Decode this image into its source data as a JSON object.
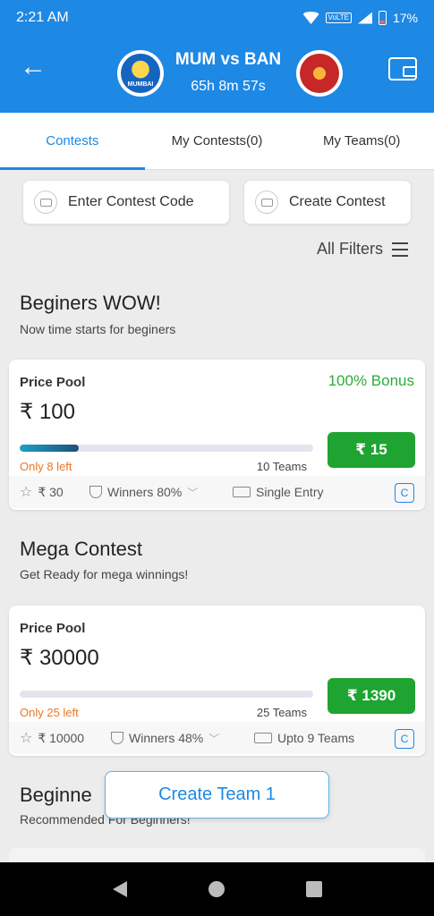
{
  "status_bar": {
    "time": "2:21 AM",
    "battery": "17%"
  },
  "header": {
    "team1_logo_text": "MUMBAI",
    "match_title": "MUM vs BAN",
    "countdown": "65h 8m 57s"
  },
  "tabs": [
    {
      "label": "Contests",
      "active": true
    },
    {
      "label": "My Contests(0)",
      "active": false
    },
    {
      "label": "My Teams(0)",
      "active": false
    }
  ],
  "actions": {
    "enter_code": "Enter Contest Code",
    "create_contest": "Create Contest"
  },
  "filters_label": "All Filters",
  "sections": [
    {
      "title": "Beginers WOW!",
      "subtitle": "Now time starts for beginers",
      "card": {
        "label": "Price Pool",
        "bonus": "100% Bonus",
        "amount": "₹ 100",
        "fill_fraction": 0.2,
        "spots_left": "Only 8 left",
        "teams": "10 Teams",
        "entry": "₹ 15",
        "first_prize": "₹ 30",
        "winners": "Winners 80%",
        "entry_type": "Single Entry",
        "badge": "C"
      }
    },
    {
      "title": "Mega Contest",
      "subtitle": "Get Ready for mega winnings!",
      "card": {
        "label": "Price Pool",
        "amount": "₹ 30000",
        "fill_fraction": 0.0,
        "spots_left": "Only 25 left",
        "teams": "25 Teams",
        "entry": "₹ 1390",
        "first_prize": "₹ 10000",
        "winners": "Winners 48%",
        "entry_type": "Upto 9 Teams",
        "badge": "C"
      }
    },
    {
      "title": "Beginne",
      "subtitle": "Recommended For Beginners!"
    }
  ],
  "create_team_label": "Create Team 1",
  "colors": {
    "primary": "#1e88e5",
    "join": "#1fa431",
    "bonus": "#2eaa3a",
    "spots": "#e87722"
  }
}
